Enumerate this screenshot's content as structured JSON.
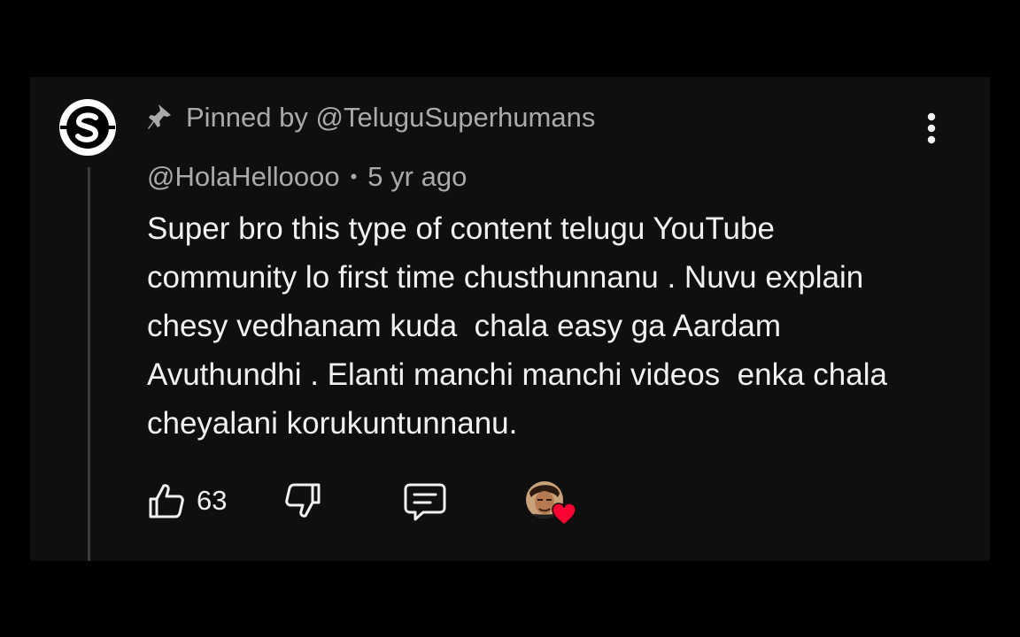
{
  "pinned": {
    "label": "Pinned by @TeluguSuperhumans"
  },
  "comment": {
    "author": "@HolaHelloooo",
    "separator": "•",
    "time": "5 yr ago",
    "text": "Super bro this type of content telugu YouTube community lo first time chusthunnanu . Nuvu explain chesy vedhanam kuda  chala easy ga Aardam Avuthundhi . Elanti manchi manchi videos  enka chala cheyalani korukuntunnanu."
  },
  "actions": {
    "like_count": "63"
  },
  "icons": {
    "avatar": "channel-logo-s-icon",
    "pin": "pin-icon",
    "more": "more-vertical-icon",
    "like": "thumbs-up-icon",
    "dislike": "thumbs-down-icon",
    "reply": "comment-reply-icon",
    "heart": "heart-icon"
  },
  "colors": {
    "page_background": "#000000",
    "card_background": "#0f0f0f",
    "primary_text": "#f1f1f1",
    "secondary_text": "#aaaaaa",
    "heart": "#ff0033"
  }
}
